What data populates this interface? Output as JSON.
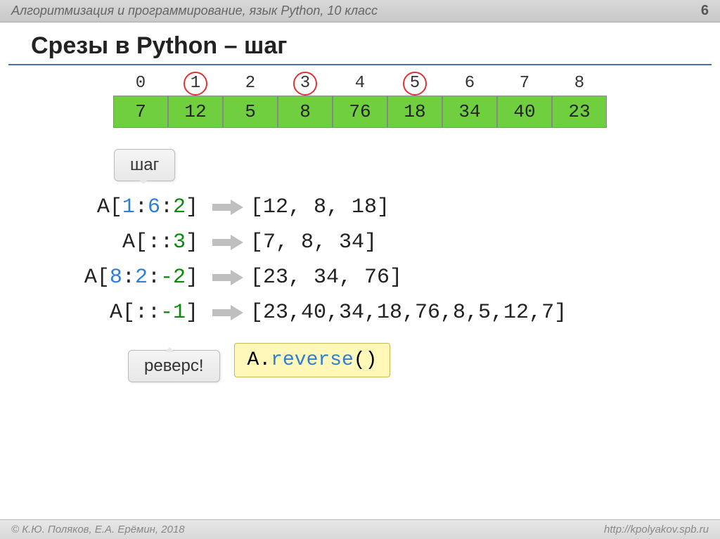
{
  "header": {
    "breadcrumb": "Алгоритмизация и программирование, язык Python, 10 класс",
    "page_number": "6"
  },
  "title": "Срезы в Python – шаг",
  "indices": [
    "0",
    "1",
    "2",
    "3",
    "4",
    "5",
    "6",
    "7",
    "8"
  ],
  "circled_indices": [
    1,
    3,
    5
  ],
  "array": [
    "7",
    "12",
    "5",
    "8",
    "76",
    "18",
    "34",
    "40",
    "23"
  ],
  "callouts": {
    "step": "шаг",
    "reverse": "реверс!"
  },
  "examples": [
    {
      "expr_prefix": "A[",
      "parts": [
        {
          "t": "1",
          "c": "b-blue"
        },
        {
          "t": ":",
          "c": ""
        },
        {
          "t": "6",
          "c": "b-blue"
        },
        {
          "t": ":",
          "c": ""
        },
        {
          "t": "2",
          "c": "b-green"
        }
      ],
      "expr_suffix": "]",
      "result": "[12, 8, 18]"
    },
    {
      "expr_prefix": "A[",
      "parts": [
        {
          "t": "::",
          "c": ""
        },
        {
          "t": "3",
          "c": "b-green"
        }
      ],
      "expr_suffix": "]",
      "result": "[7, 8, 34]"
    },
    {
      "expr_prefix": "A[",
      "parts": [
        {
          "t": "8",
          "c": "b-blue"
        },
        {
          "t": ":",
          "c": ""
        },
        {
          "t": "2",
          "c": "b-blue"
        },
        {
          "t": ":",
          "c": ""
        },
        {
          "t": "-2",
          "c": "b-green"
        }
      ],
      "expr_suffix": "]",
      "result": "[23, 34, 76]"
    },
    {
      "expr_prefix": "A[",
      "parts": [
        {
          "t": "::",
          "c": ""
        },
        {
          "t": "-1",
          "c": "b-green"
        }
      ],
      "expr_suffix": "]",
      "result": "[23,40,34,18,76,8,5,12,7]"
    }
  ],
  "reverse_code": {
    "prefix": "A.",
    "method": "reverse",
    "suffix": "()"
  },
  "footer": {
    "copyright": "© К.Ю. Поляков, Е.А. Ерёмин, 2018",
    "url": "http://kpolyakov.spb.ru"
  }
}
